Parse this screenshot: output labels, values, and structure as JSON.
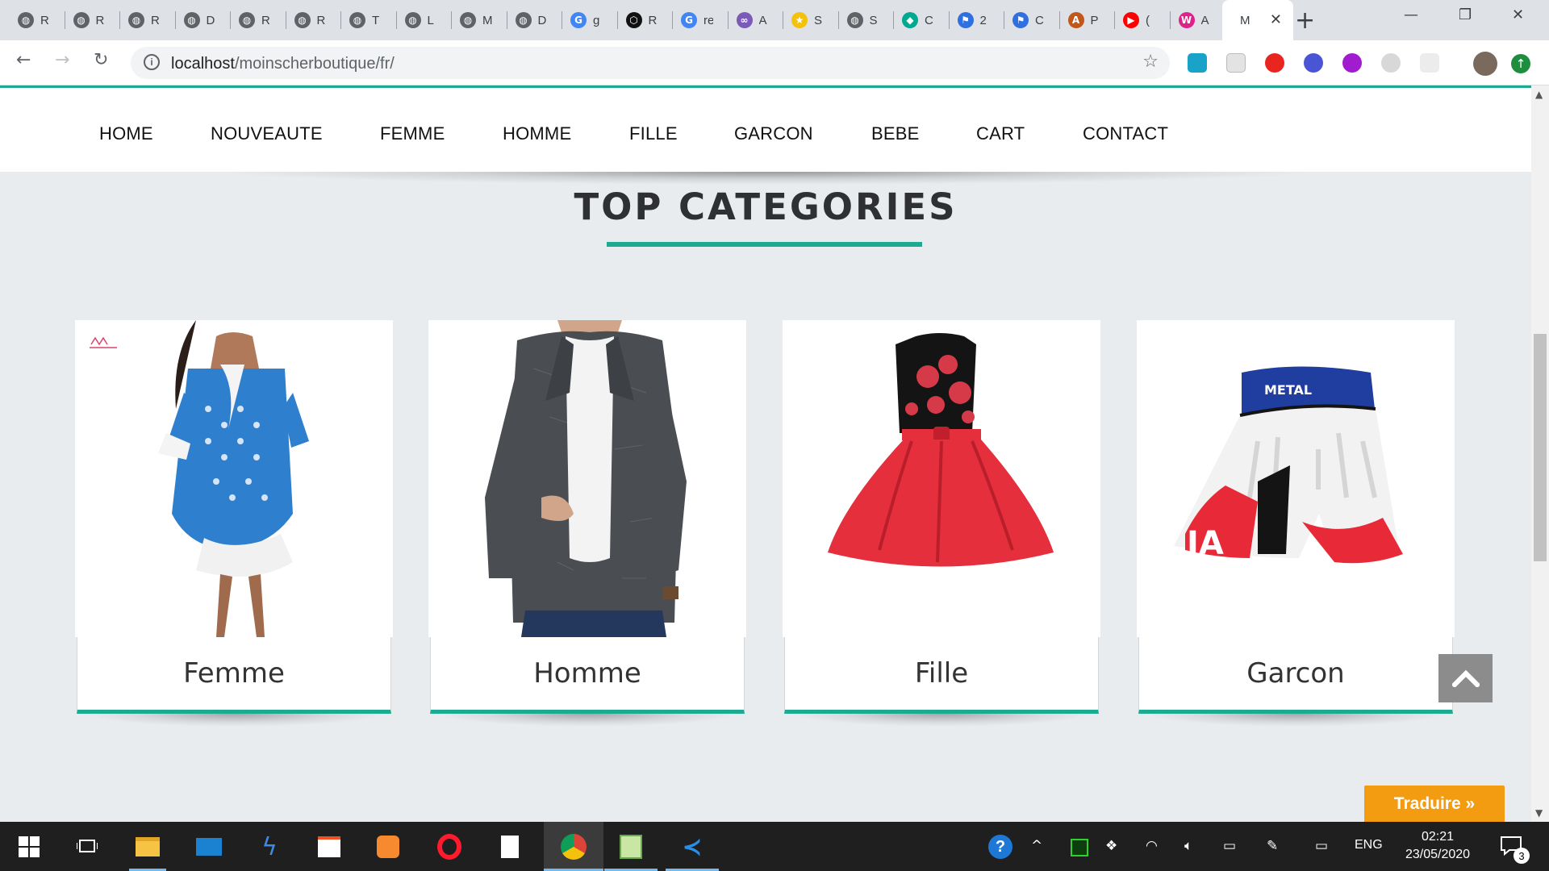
{
  "browser": {
    "tabs": [
      {
        "title": "R",
        "icon": "globe-icon",
        "color": "#5f6368"
      },
      {
        "title": "R",
        "icon": "globe-icon",
        "color": "#5f6368"
      },
      {
        "title": "R",
        "icon": "globe-icon",
        "color": "#5f6368"
      },
      {
        "title": "D",
        "icon": "globe-icon",
        "color": "#5f6368"
      },
      {
        "title": "R",
        "icon": "globe-icon",
        "color": "#5f6368"
      },
      {
        "title": "R",
        "icon": "globe-icon",
        "color": "#5f6368"
      },
      {
        "title": "T",
        "icon": "globe-icon",
        "color": "#5f6368"
      },
      {
        "title": "L",
        "icon": "globe-icon",
        "color": "#5f6368"
      },
      {
        "title": "M",
        "icon": "globe-icon",
        "color": "#5f6368"
      },
      {
        "title": "D",
        "icon": "globe-icon",
        "color": "#5f6368"
      },
      {
        "title": "g",
        "icon": "google-icon",
        "color": "#4285f4"
      },
      {
        "title": "R",
        "icon": "codepen-icon",
        "color": "#111111"
      },
      {
        "title": "re",
        "icon": "google-icon",
        "color": "#4285f4"
      },
      {
        "title": "A",
        "icon": "knot-icon",
        "color": "#7a5ab8"
      },
      {
        "title": "S",
        "icon": "star-badge-icon",
        "color": "#f4c20d"
      },
      {
        "title": "S",
        "icon": "globe-icon",
        "color": "#5f6368"
      },
      {
        "title": "C",
        "icon": "diamond-icon",
        "color": "#00a98f"
      },
      {
        "title": "2",
        "icon": "flag-icon",
        "color": "#2f6fe0"
      },
      {
        "title": "C",
        "icon": "flag-icon",
        "color": "#2f6fe0"
      },
      {
        "title": "P",
        "icon": "a-circle-icon",
        "color": "#c2571a"
      },
      {
        "title": "(",
        "icon": "youtube-icon",
        "color": "#ff0000"
      },
      {
        "title": "A",
        "icon": "w-square-icon",
        "color": "#e0218a"
      },
      {
        "title": "M",
        "icon": "none",
        "color": "#ffffff",
        "active": true
      }
    ],
    "url_host": "localhost",
    "url_path": "/moinscherboutique/fr/"
  },
  "site": {
    "nav": [
      "HOME",
      "NOUVEAUTE",
      "FEMME",
      "HOMME",
      "FILLE",
      "GARCON",
      "BEBE",
      "CART",
      "CONTACT"
    ],
    "section_title": "TOP CATEGORIES",
    "categories": [
      {
        "label": "Femme",
        "image": "dress-image"
      },
      {
        "label": "Homme",
        "image": "blazer-image"
      },
      {
        "label": "Fille",
        "image": "girl-dress-image"
      },
      {
        "label": "Garcon",
        "image": "shorts-image"
      }
    ],
    "translate_label": "Traduire »",
    "accent_color": "#1eaa91"
  },
  "taskbar": {
    "language": "ENG",
    "time": "02:21",
    "date": "23/05/2020",
    "notifications": "3"
  }
}
